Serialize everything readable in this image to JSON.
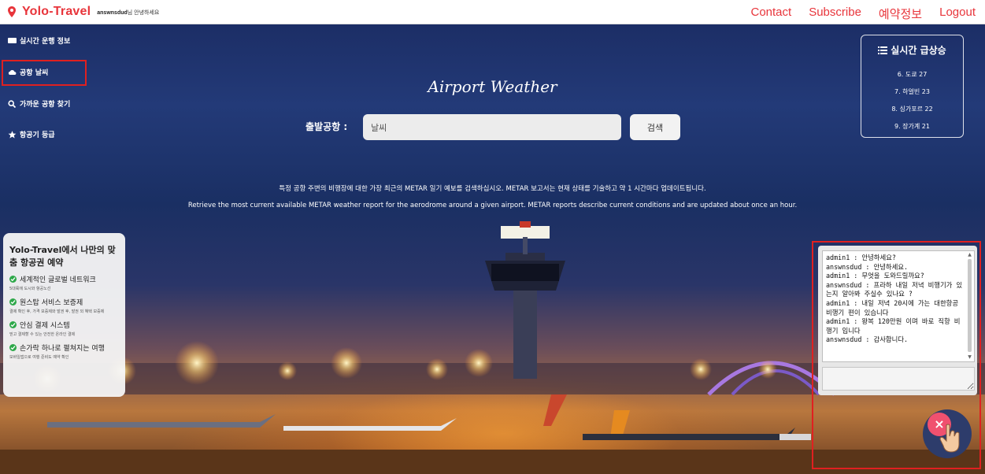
{
  "header": {
    "brand": "Yolo-Travel",
    "user": "answnsdud",
    "greeting_suffix": "님 안녕하세요",
    "nav": [
      "Contact",
      "Subscribe",
      "예약정보",
      "Logout"
    ]
  },
  "sidebar": {
    "items": [
      {
        "label": "실시간 운행 정보",
        "icon": "monitor-icon"
      },
      {
        "label": "공항 날씨",
        "icon": "cloud-icon"
      },
      {
        "label": "가까운 공항 찾기",
        "icon": "search-icon"
      },
      {
        "label": "항공기 등급",
        "icon": "star-icon"
      }
    ]
  },
  "main": {
    "title": "Airport Weather",
    "search_label": "출발공항 :",
    "search_value": "날씨",
    "search_button": "검색",
    "desc_ko": "특정 공항 주변의 비행장에 대한 가장 최근의 METAR 일기 예보를 검색하십시오. METAR 보고서는 현재 상태를 기술하고 약 1 시간마다 업데이트됩니다.",
    "desc_en": "Retrieve the most current available METAR weather report for the aerodrome around a given airport. METAR reports describe current conditions and are updated about once an hour."
  },
  "trending": {
    "title": "실시간 급상승",
    "icon": "list-icon",
    "items": [
      "6. 도쿄 27",
      "7. 하얼빈 23",
      "8. 싱가포르 22",
      "9. 장가계 21"
    ]
  },
  "promo": {
    "title": "Yolo-Travel에서 나만의 맞춤 항공권 예약",
    "items": [
      {
        "heading": "세계적인 글로벌 네트워크",
        "sub": "5대륙에 도시와 항공노선"
      },
      {
        "heading": "원스탑 서비스 보증제",
        "sub": "결제 확인 후, 가격 보증제와 발권 후, 발권 외 혜택 보증제"
      },
      {
        "heading": "안심 결제 시스템",
        "sub": "믿고 결제할 수 있는 안전한 온라인 결제"
      },
      {
        "heading": "손가락 하나로 펼쳐지는 여행",
        "sub": "모바일앱으로 여행 준비도 예약 확인"
      }
    ]
  },
  "chat": {
    "messages": [
      "admin1 : 안녕하세요?",
      "answnsdud : 안녕하세요.",
      "admin1 : 무엇을 도와드릴까요?",
      "answnsdud : 프라하 내일 저녁 비행기가 있는지 알아봐 주실수 있나요 ?",
      "admin1 : 내일 저녁 20시에 가는 대한항공 비행기 편이 있습니다",
      "admin1 : 왕복 120만원 이며 바로 직항 비행기 입니다",
      "answnsdud : 감사합니다."
    ],
    "input_value": "",
    "close_label": "×"
  },
  "colors": {
    "brand_red": "#e8353b",
    "highlight_red": "#e02020",
    "check_green": "#2ea84a",
    "fab_pink": "#f0516f"
  }
}
